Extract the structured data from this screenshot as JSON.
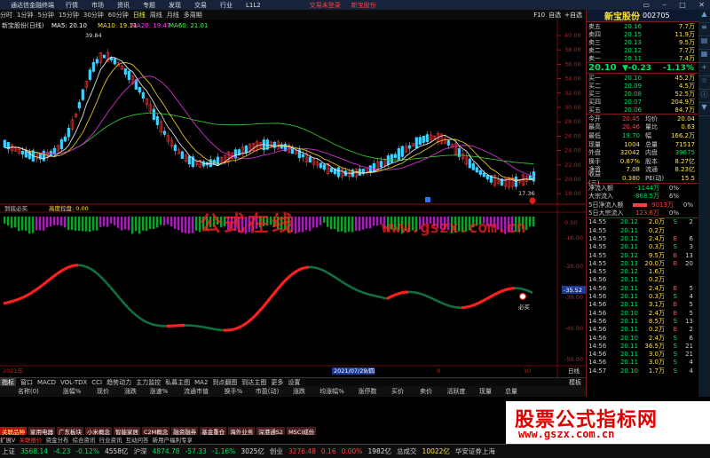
{
  "titlebar": {
    "app": "通达信金融终端",
    "menu": [
      "行情",
      "市场",
      "资讯",
      "专题",
      "发现",
      "交易",
      "行业",
      "L1L2"
    ],
    "promo": [
      "交易未登录",
      "新宝股份"
    ]
  },
  "toolbar": {
    "periods": [
      "分时",
      "1分钟",
      "5分钟",
      "15分钟",
      "30分钟",
      "60分钟",
      "日线",
      "周线",
      "月线",
      "多周期"
    ],
    "active_period": "日线",
    "right": [
      "F10",
      "自选",
      "+自选"
    ]
  },
  "chart": {
    "header": {
      "name": "新宝股份(日线)",
      "ma5": "MA5: 20.10",
      "ma10": "MA10: 19.11",
      "ma20": "MA20: 19.47",
      "ma60": "MA60: 21.01"
    },
    "high_label": "39.84",
    "low_label": "17.36",
    "price_axis": [
      "40.00",
      "38.00",
      "36.00",
      "34.00",
      "32.00",
      "30.00",
      "28.00",
      "26.00",
      "24.00",
      "22.00",
      "20.00",
      "18.00"
    ],
    "indicator1": {
      "name": "到底必买",
      "label": "高度控盘: 0.00",
      "axis": [
        "0.00",
        "-10.00"
      ]
    },
    "indicator2": {
      "axis": [
        "-20.00",
        "-30.00",
        "-40.00",
        "-50.00"
      ],
      "current": "-35.52",
      "buy_label": "必买"
    },
    "date_labels": [
      "2021年",
      "2021/07/29/四",
      "9",
      "10"
    ],
    "period_label": "日线"
  },
  "tabs": {
    "items": [
      "指标",
      "窗口",
      "MACD",
      "VOL-TDX",
      "CCI",
      "趋势动力",
      "主力监控",
      "私募主图",
      "MA2",
      "到点翻图",
      "到达主图",
      "更多",
      "设置"
    ],
    "active": "指标",
    "right": "模板"
  },
  "list_header": [
    "名称(0)",
    "涨幅%",
    "现价",
    "涨跌",
    "涨速%",
    "流通市值",
    "换手%",
    "市盈(动)",
    "涨跌",
    "均涨幅%",
    "涨停数",
    "买价",
    "卖价",
    "活跃度",
    "现量",
    "总量"
  ],
  "side": {
    "name": "新宝股份",
    "code": "002705",
    "price": "20.10",
    "change": "▼-0.23",
    "pct": "-1.13%",
    "asks": [
      [
        "卖五",
        "20.16",
        "7.7万"
      ],
      [
        "卖四",
        "20.15",
        "11.9万"
      ],
      [
        "卖三",
        "20.13",
        "9.5万"
      ],
      [
        "卖二",
        "20.12",
        "7.7万"
      ],
      [
        "卖一",
        "20.11",
        "7.4万"
      ]
    ],
    "bids": [
      [
        "买一",
        "20.10",
        "45.2万"
      ],
      [
        "买二",
        "20.09",
        "4.5万"
      ],
      [
        "买三",
        "20.08",
        "52.5万"
      ],
      [
        "买四",
        "20.07",
        "204.9万"
      ],
      [
        "买五",
        "20.06",
        "84.7万"
      ]
    ],
    "stats": [
      [
        "今开",
        "20.45",
        "均价",
        "20.04"
      ],
      [
        "最高",
        "20.46",
        "量比",
        "0.63"
      ],
      [
        "最低",
        "19.70",
        "幅",
        "166.2万"
      ],
      [
        "现量",
        "1004",
        "总量",
        "71517"
      ],
      [
        "外盘",
        "32042",
        "内盘",
        "39675"
      ],
      [
        "换手",
        "0.87%",
        "股本",
        "8.27亿"
      ],
      [
        "净资",
        "7.08",
        "流通",
        "8.23亿"
      ],
      [
        "收益(三)",
        "0.380",
        "PE(动)",
        "15.5"
      ]
    ],
    "flows": [
      [
        "净流入额",
        "-1144万",
        "0%"
      ],
      [
        "大宗流入",
        "-868.5万",
        "6%"
      ],
      [
        "5日净流入额",
        "9013万",
        "0%"
      ],
      [
        "5日大宗流入",
        "123.6万",
        "0%"
      ]
    ],
    "ticks": [
      [
        "14:55",
        "20.12",
        "2.0万",
        "S",
        "2"
      ],
      [
        "14:55",
        "20.11",
        "0.2万",
        "",
        ""
      ],
      [
        "14:55",
        "20.12",
        "2.4万",
        "B",
        "6"
      ],
      [
        "14:55",
        "20.11",
        "0.3万",
        "S",
        "3"
      ],
      [
        "14:55",
        "20.12",
        "9.5万",
        "B",
        "13"
      ],
      [
        "14:55",
        "20.13",
        "20.0万",
        "B",
        "20"
      ],
      [
        "14:55",
        "20.12",
        "1.6万",
        "",
        ""
      ],
      [
        "14:56",
        "20.11",
        "0.2万",
        "",
        ""
      ],
      [
        "14:56",
        "20.11",
        "2.4万",
        "B",
        "5"
      ],
      [
        "14:56",
        "20.11",
        "0.3万",
        "S",
        "4"
      ],
      [
        "14:56",
        "20.11",
        "3.1万",
        "B",
        "5"
      ],
      [
        "14:56",
        "20.10",
        "2.4万",
        "B",
        "5"
      ],
      [
        "14:56",
        "20.11",
        "8.5万",
        "S",
        "13"
      ],
      [
        "14:56",
        "20.11",
        "0.2万",
        "B",
        "2"
      ],
      [
        "14:56",
        "20.10",
        "2.4万",
        "S",
        "6"
      ],
      [
        "14:56",
        "20.11",
        "36.5万",
        "S",
        "21"
      ],
      [
        "14:56",
        "20.11",
        "3.0万",
        "S",
        "21"
      ],
      [
        "14:56",
        "20.11",
        "3.0万",
        "S",
        "4"
      ],
      [
        "14:57",
        "20.10",
        "1.7万",
        "S",
        "4"
      ]
    ]
  },
  "sectors": [
    "关联品种",
    "家用电器",
    "广东板块",
    "小米概念",
    "智能家居",
    "C2M概念",
    "融资融券",
    "基金重仓",
    "海外业务",
    "深港通S2",
    "MSCI成份"
  ],
  "bottomtabs": [
    "扩展V",
    "关联报价",
    "资金分布",
    "综合资讯",
    "行业资讯",
    "互动问答",
    "新用户福利专享"
  ],
  "status": {
    "sh_name": "上证",
    "sh": "3568.14",
    "sh_chg": "-4.23",
    "sh_pct": "-0.12%",
    "sh_amt": "4558亿",
    "hs_name": "沪深",
    "hs": "4874.78",
    "hs_chg": "-57.33",
    "hs_pct": "-1.16%",
    "hs_amt": "3025亿",
    "cy_name": "创业",
    "cy": "3276.48",
    "cy_chg": "0.16",
    "cy_pct": "0.00%",
    "cy_amt": "1982亿",
    "total": "总成交",
    "total_val": "10022亿",
    "broker": "华安证券上海"
  },
  "watermarks": {
    "a": "公式在线",
    "b": "www.gszx.com.cn"
  },
  "ad": {
    "line1": "股票公式指标网",
    "line2": "www.gszx.com.cn"
  }
}
